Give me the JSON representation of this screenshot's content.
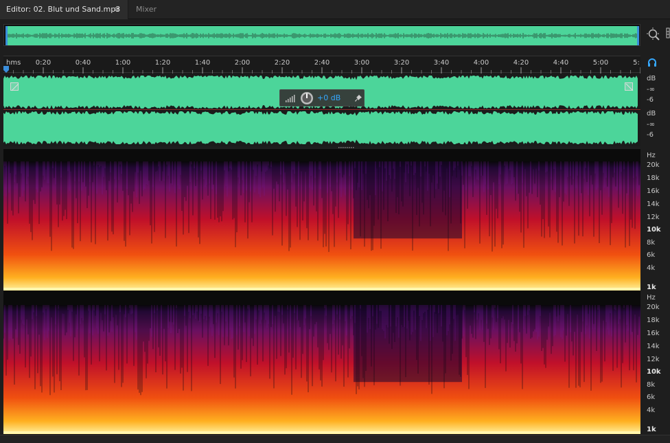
{
  "tabs": {
    "editor_label": "Editor: 02. Blut und Sand.mp3",
    "menu_glyph": "≡",
    "mixer_label": "Mixer"
  },
  "ruler": {
    "unit_label": "hms",
    "ticks": [
      "0:20",
      "0:40",
      "1:00",
      "1:20",
      "1:40",
      "2:00",
      "2:20",
      "2:40",
      "3:00",
      "3:20",
      "3:40",
      "4:00",
      "4:20",
      "4:40",
      "5:00",
      "5:"
    ]
  },
  "hud": {
    "volume_value": "+0 dB"
  },
  "amplitude_scale": {
    "unit": "dB",
    "labels": [
      "-∞",
      "-6"
    ]
  },
  "frequency_scale": {
    "unit": "Hz",
    "labels": [
      "20k",
      "18k",
      "16k",
      "14k",
      "12k",
      "10k",
      "8k",
      "6k",
      "4k",
      "1k"
    ],
    "bold": [
      "10k",
      "1k"
    ]
  },
  "colors": {
    "waveform": "#4cd59a",
    "accent_blue": "#35a8ff",
    "selection_divider": "#8c2a2a"
  },
  "icons": {
    "zoom": "zoom-to-selection-icon",
    "monitor": "headphones-icon",
    "pin": "pin-icon",
    "volume": "volume-bars-icon"
  }
}
